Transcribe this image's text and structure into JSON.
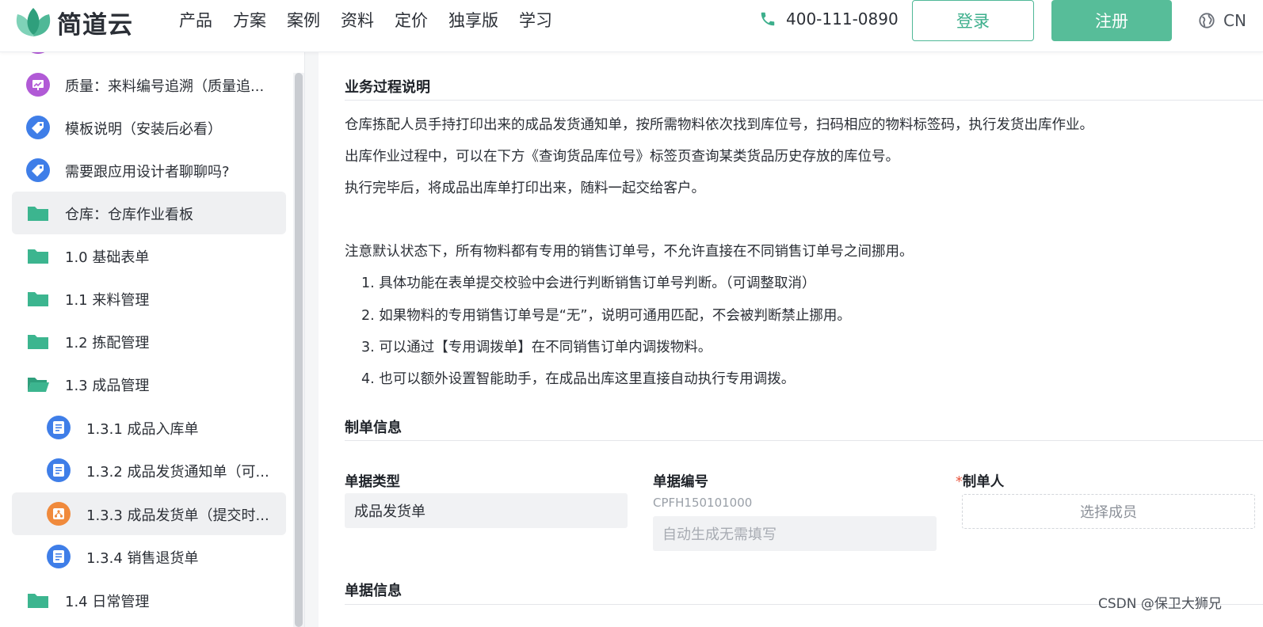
{
  "header": {
    "logo_text": "简道云",
    "nav": [
      "产品",
      "方案",
      "案例",
      "资料",
      "定价",
      "独享版",
      "学习"
    ],
    "phone": "400-111-0890",
    "login_label": "登录",
    "register_label": "注册",
    "lang": "CN"
  },
  "sidebar": {
    "items": [
      {
        "label": "质量：来料编号追溯（质量追...",
        "icon": "chart-icon",
        "color": "#b15ad6"
      },
      {
        "label": "模板说明（安装后必看）",
        "icon": "tag-icon",
        "color": "#3f7ee8"
      },
      {
        "label": "需要跟应用设计者聊聊吗?",
        "icon": "tag-icon",
        "color": "#3f7ee8"
      },
      {
        "label": "仓库：仓库作业看板",
        "icon": "folder-icon",
        "color": "#3cb58f"
      },
      {
        "label": "1.0 基础表单",
        "icon": "folder-icon",
        "color": "#3cb58f"
      },
      {
        "label": "1.1 来料管理",
        "icon": "folder-icon",
        "color": "#3cb58f"
      },
      {
        "label": "1.2 拣配管理",
        "icon": "folder-icon",
        "color": "#3cb58f"
      },
      {
        "label": "1.3 成品管理",
        "icon": "folder-open-icon",
        "color": "#3cb58f"
      },
      {
        "label": "1.3.1 成品入库单",
        "icon": "form-icon",
        "color": "#3f7ee8"
      },
      {
        "label": "1.3.2 成品发货通知单（可...",
        "icon": "form-icon",
        "color": "#3f7ee8"
      },
      {
        "label": "1.3.3 成品发货单（提交时...",
        "icon": "flow-icon",
        "color": "#f08a3c"
      },
      {
        "label": "1.3.4 销售退货单",
        "icon": "form-icon",
        "color": "#3f7ee8"
      },
      {
        "label": "1.4 日常管理",
        "icon": "folder-icon",
        "color": "#3cb58f"
      }
    ]
  },
  "main": {
    "section1_title": "业务过程说明",
    "paragraphs": [
      "仓库拣配人员手持打印出来的成品发货通知单，按所需物料依次找到库位号，扫码相应的物料标签码，执行发货出库作业。",
      "出库作业过程中，可以在下方《查询货品库位号》标签页查询某类货品历史存放的库位号。",
      "执行完毕后，将成品出库单打印出来，随料一起交给客户。"
    ],
    "note": "注意默认状态下，所有物料都有专用的销售订单号，不允许直接在不同销售订单号之间挪用。",
    "list": [
      "1. 具体功能在表单提交校验中会进行判断销售订单号判断。（可调整取消）",
      "2. 如果物料的专用销售订单号是“无”，说明可通用匹配，不会被判断禁止挪用。",
      "3. 可以通过【专用调拨单】在不同销售订单内调拨物料。",
      "4. 也可以额外设置智能助手，在成品出库这里直接自动执行专用调拨。"
    ],
    "section2_title": "制单信息",
    "doc_type_label": "单据类型",
    "doc_type_value": "成品发货单",
    "doc_no_label": "单据编号",
    "doc_no_hint": "CPFH150101000",
    "doc_no_placeholder": "自动生成无需填写",
    "maker_required": "*",
    "maker_label": "制单人",
    "maker_placeholder": "选择成员",
    "section3_title": "单据信息"
  },
  "watermark": "CSDN @保卫大狮兄",
  "colors": {
    "brand": "#57bd99",
    "brand_text": "#3daf8c",
    "required": "#e8553e"
  }
}
